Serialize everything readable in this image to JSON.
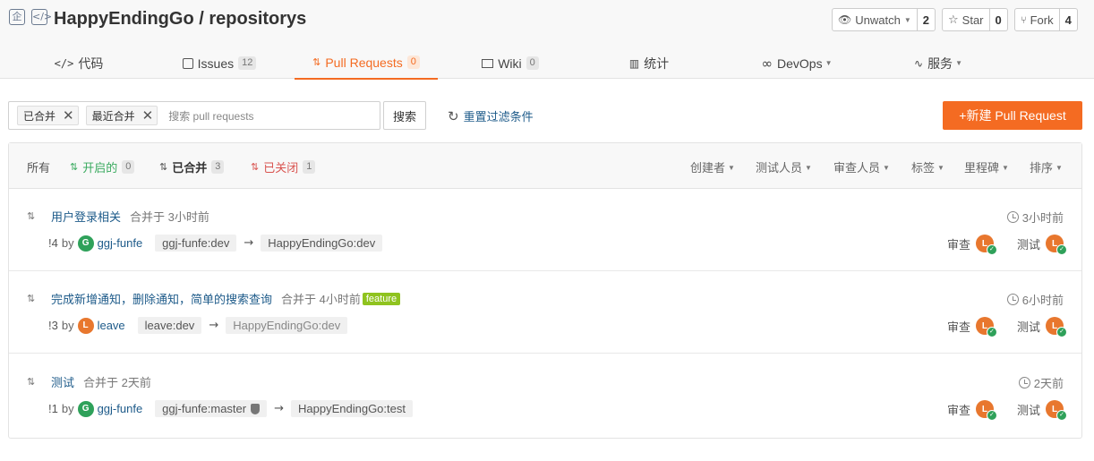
{
  "header": {
    "repo_owner": "HappyEndingGo",
    "separator": "/",
    "repo_name": "repositorys",
    "repo_icon_char": "企",
    "watch": {
      "label": "Unwatch",
      "count": "2"
    },
    "star": {
      "label": "Star",
      "count": "0"
    },
    "fork": {
      "label": "Fork",
      "count": "4"
    }
  },
  "tabs": [
    {
      "label": "代码",
      "icon": "code-icon"
    },
    {
      "label": "Issues",
      "badge": "12",
      "icon": "issues-icon"
    },
    {
      "label": "Pull Requests",
      "badge": "0",
      "icon": "pull-request-icon"
    },
    {
      "label": "Wiki",
      "badge": "0",
      "icon": "wiki-icon"
    },
    {
      "label": "统计",
      "icon": "stats-icon"
    },
    {
      "label": "DevOps",
      "icon": "devops-icon"
    },
    {
      "label": "服务",
      "icon": "service-icon"
    }
  ],
  "filter": {
    "chips": [
      "已合并",
      "最近合并"
    ],
    "placeholder": "搜索 pull requests",
    "search_button": "搜索",
    "reset": "重置过滤条件",
    "new_pr": "+新建 Pull Request"
  },
  "status_tabs": [
    {
      "label": "所有"
    },
    {
      "label": "开启的",
      "badge": "0"
    },
    {
      "label": "已合并",
      "badge": "3"
    },
    {
      "label": "已关闭",
      "badge": "1"
    }
  ],
  "dropdowns": [
    "创建者",
    "测试人员",
    "审查人员",
    "标签",
    "里程碑",
    "排序"
  ],
  "pull_requests": [
    {
      "title": "用户登录相关",
      "meta": "合并于 3小时前",
      "label": "",
      "number": "!4",
      "by": "by",
      "avatar": "G",
      "user": "ggj-funfe",
      "source": "ggj-funfe:dev",
      "target": "HappyEndingGo:dev",
      "time": "3小时前",
      "review": "审查",
      "test": "测试"
    },
    {
      "title": "完成新增通知，删除通知，简单的搜索查询",
      "meta": "合并于 4小时前",
      "label": "feature",
      "number": "!3",
      "by": "by",
      "avatar": "L",
      "user": "leave",
      "source": "leave:dev",
      "target": "HappyEndingGo:dev",
      "time": "6小时前",
      "review": "审查",
      "test": "测试"
    },
    {
      "title": "测试",
      "meta": "合并于 2天前",
      "label": "",
      "number": "!1",
      "by": "by",
      "avatar": "G",
      "user": "ggj-funfe",
      "source": "ggj-funfe:master",
      "target": "HappyEndingGo:test",
      "time": "2天前",
      "review": "审查",
      "test": "测试"
    }
  ],
  "colors": {
    "accent": "#f46b22",
    "link": "#1e5b8a",
    "green": "#3aaa5f",
    "red": "#d9534f"
  }
}
